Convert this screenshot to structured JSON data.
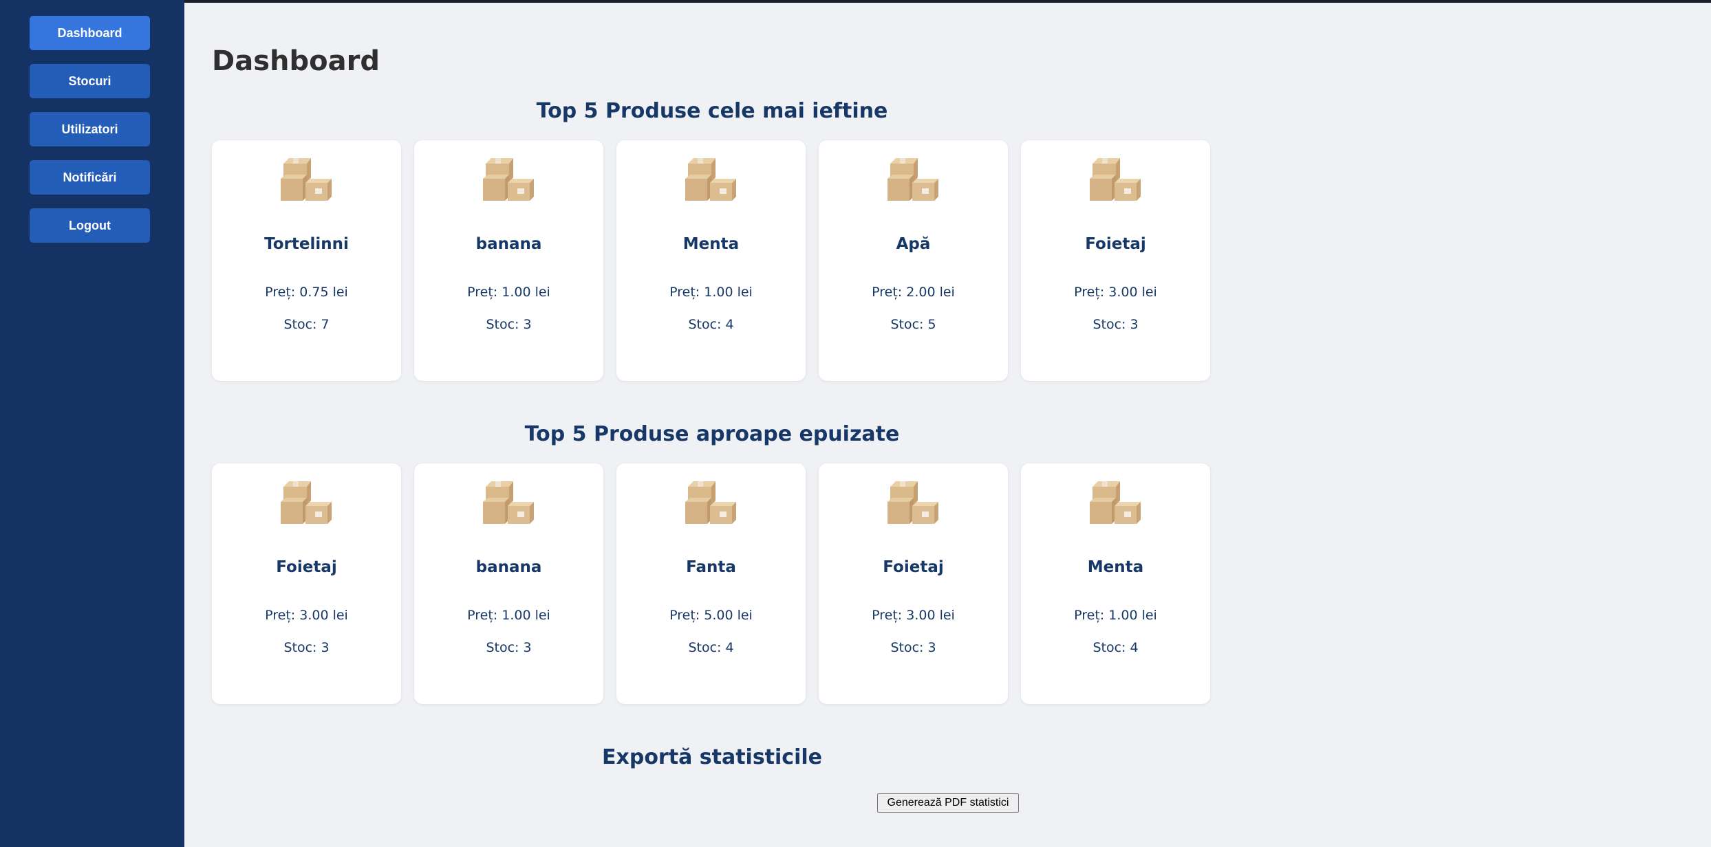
{
  "sidebar": {
    "items": [
      {
        "label": "Dashboard",
        "active": true
      },
      {
        "label": "Stocuri",
        "active": false
      },
      {
        "label": "Utilizatori",
        "active": false
      },
      {
        "label": "Notificări",
        "active": false
      },
      {
        "label": "Logout",
        "active": false
      }
    ]
  },
  "main": {
    "title": "Dashboard",
    "cheapest": {
      "title": "Top 5 Produse cele mai ieftine",
      "products": [
        {
          "name": "Tortelinni",
          "price": "Preț: 0.75 lei",
          "stock": "Stoc: 7",
          "icon": "boxes-icon"
        },
        {
          "name": "banana",
          "price": "Preț: 1.00 lei",
          "stock": "Stoc: 3",
          "icon": "boxes-icon"
        },
        {
          "name": "Menta",
          "price": "Preț: 1.00 lei",
          "stock": "Stoc: 4",
          "icon": "boxes-icon"
        },
        {
          "name": "Apă",
          "price": "Preț: 2.00 lei",
          "stock": "Stoc: 5",
          "icon": "boxes-icon"
        },
        {
          "name": "Foietaj",
          "price": "Preț: 3.00 lei",
          "stock": "Stoc: 3",
          "icon": "boxes-icon"
        }
      ]
    },
    "low_stock": {
      "title": "Top 5 Produse aproape epuizate",
      "products": [
        {
          "name": "Foietaj",
          "price": "Preț: 3.00 lei",
          "stock": "Stoc: 3",
          "icon": "boxes-icon"
        },
        {
          "name": "banana",
          "price": "Preț: 1.00 lei",
          "stock": "Stoc: 3",
          "icon": "boxes-icon"
        },
        {
          "name": "Fanta",
          "price": "Preț: 5.00 lei",
          "stock": "Stoc: 4",
          "icon": "boxes-icon"
        },
        {
          "name": "Foietaj",
          "price": "Preț: 3.00 lei",
          "stock": "Stoc: 3",
          "icon": "boxes-icon"
        },
        {
          "name": "Menta",
          "price": "Preț: 1.00 lei",
          "stock": "Stoc: 4",
          "icon": "boxes-icon"
        }
      ]
    },
    "export": {
      "title": "Exportă statisticile",
      "button_label": "Generează PDF statistici"
    }
  },
  "colors": {
    "sidebar_bg": "#143264",
    "nav_button": "#245db8",
    "nav_button_active": "#3576de",
    "page_bg": "#eff1f5",
    "heading_blue": "#173867"
  }
}
